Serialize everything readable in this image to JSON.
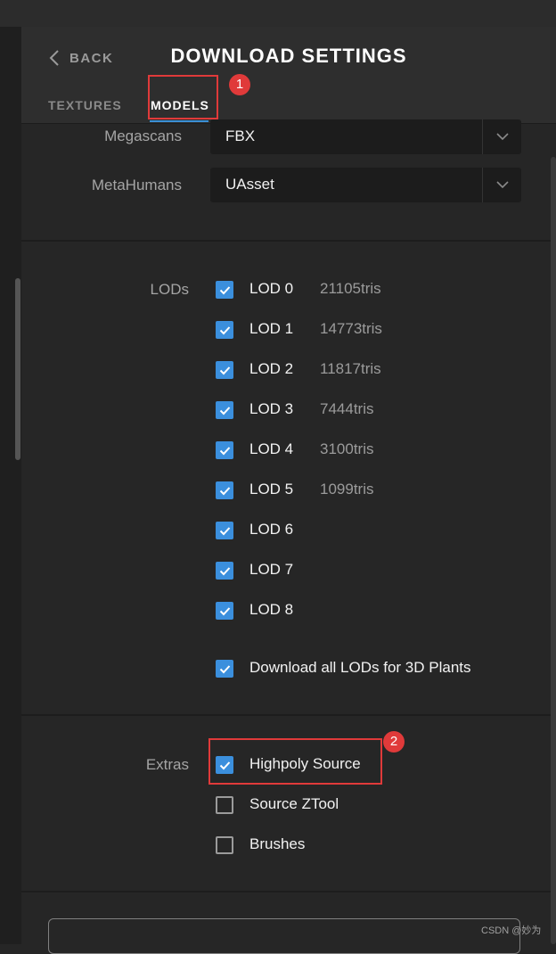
{
  "header": {
    "back_label": "BACK",
    "title": "DOWNLOAD SETTINGS",
    "tabs": [
      {
        "label": "TEXTURES",
        "active": false
      },
      {
        "label": "MODELS",
        "active": true
      }
    ],
    "accent": "#3d8fd6"
  },
  "formats": [
    {
      "label": "Megascans",
      "value": "FBX"
    },
    {
      "label": "MetaHumans",
      "value": "UAsset"
    }
  ],
  "lods": {
    "label": "LODs",
    "items": [
      {
        "label": "LOD 0",
        "tris": "21105tris",
        "checked": true
      },
      {
        "label": "LOD 1",
        "tris": "14773tris",
        "checked": true
      },
      {
        "label": "LOD 2",
        "tris": "11817tris",
        "checked": true
      },
      {
        "label": "LOD 3",
        "tris": "7444tris",
        "checked": true
      },
      {
        "label": "LOD 4",
        "tris": "3100tris",
        "checked": true
      },
      {
        "label": "LOD 5",
        "tris": "1099tris",
        "checked": true
      },
      {
        "label": "LOD 6",
        "tris": "",
        "checked": true
      },
      {
        "label": "LOD 7",
        "tris": "",
        "checked": true
      },
      {
        "label": "LOD 8",
        "tris": "",
        "checked": true
      }
    ],
    "download_all": {
      "label": "Download all LODs for 3D Plants",
      "checked": true
    }
  },
  "extras": {
    "label": "Extras",
    "items": [
      {
        "label": "Highpoly Source",
        "checked": true
      },
      {
        "label": "Source ZTool",
        "checked": false
      },
      {
        "label": "Brushes",
        "checked": false
      }
    ]
  },
  "annotations": [
    "1",
    "2"
  ],
  "annotation_color": "#e03a3a",
  "checkbox_color": "#3b8fdd",
  "watermark": "CSDN @妙为"
}
